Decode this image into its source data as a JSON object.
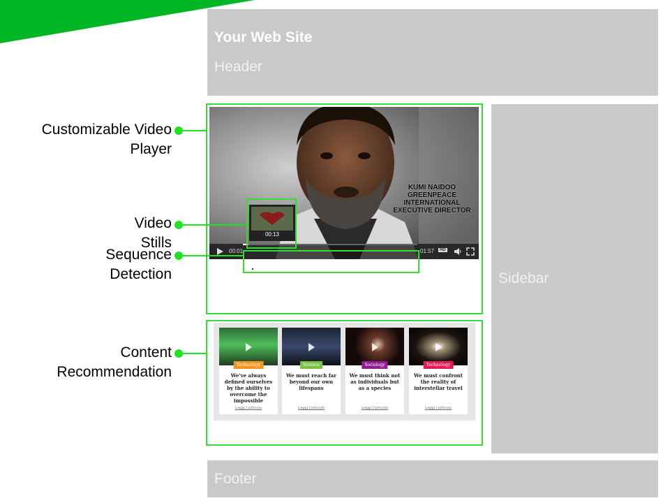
{
  "header": {
    "title": "Your Web Site",
    "subtitle": "Header"
  },
  "sidebar": {
    "label": "Sidebar"
  },
  "footer": {
    "label": "Footer"
  },
  "annotations": {
    "video_player_line1": "Customizable Video",
    "video_player_line2": "Player",
    "stills_line1": "Video",
    "stills_line2": "Stills",
    "sequence_line1": "Sequence",
    "sequence_line2": "Detection",
    "content_line1": "Content",
    "content_line2": "Recommendation"
  },
  "video": {
    "caption_lines": [
      "KUMI NAIDOO",
      "GREENPEACE",
      "INTERNATIONAL",
      "EXECUTIVE DIRECTOR"
    ],
    "current_time": "00:01",
    "duration": "01:57",
    "hd_badge": "HD",
    "preview_time": "00:13"
  },
  "recommendations": [
    {
      "category": "Technology",
      "category_color": "#f7941d",
      "title": "We've always defined ourselves by the ability to overcome the impossible",
      "link": "Leggi l'articolo"
    },
    {
      "category": "Science",
      "category_color": "#7ac143",
      "title": "We must reach far beyond our own lifespans",
      "link": "Leggi l'articolo"
    },
    {
      "category": "Sociology",
      "category_color": "#8e1e8e",
      "title": "We must think not as individuals but as a species",
      "link": "Leggi l'articolo"
    },
    {
      "category": "Technology",
      "category_color": "#e6195a",
      "title": "We must confront the reality of interstellar travel",
      "link": "Leggi l'articolo"
    }
  ],
  "colors": {
    "accent_green": "#22e022",
    "banner_green": "#00b624",
    "layout_gray": "#c9c9c9"
  }
}
